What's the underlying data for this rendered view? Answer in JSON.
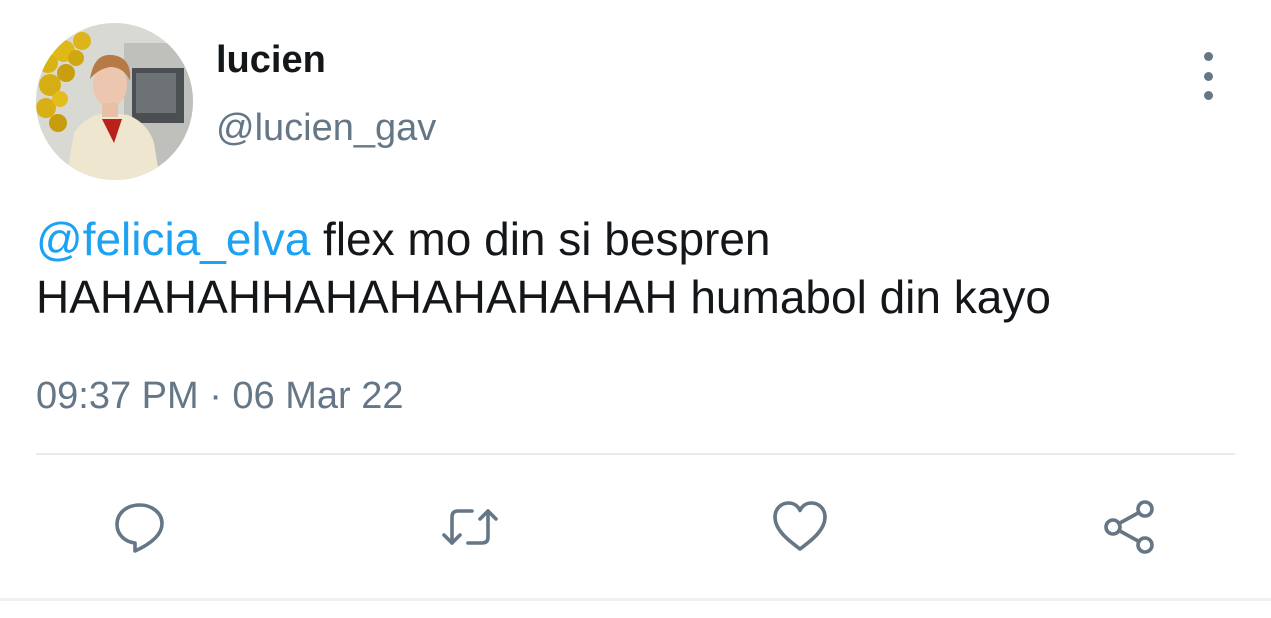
{
  "user": {
    "display_name": "lucien",
    "handle": "@lucien_gav"
  },
  "tweet": {
    "mention": "@felicia_elva",
    "text_line1": " flex mo din si bespren",
    "text_line2": "HAHAHAHHAHAHAHAHAHAH humabol din kayo",
    "timestamp": "09:37 PM · 06 Mar 22"
  },
  "colors": {
    "link": "#1da1f2",
    "text_primary": "#14171a",
    "text_secondary": "#657786"
  },
  "actions": {
    "reply_icon": "reply-icon",
    "retweet_icon": "retweet-icon",
    "like_icon": "heart-icon",
    "share_icon": "share-icon"
  }
}
